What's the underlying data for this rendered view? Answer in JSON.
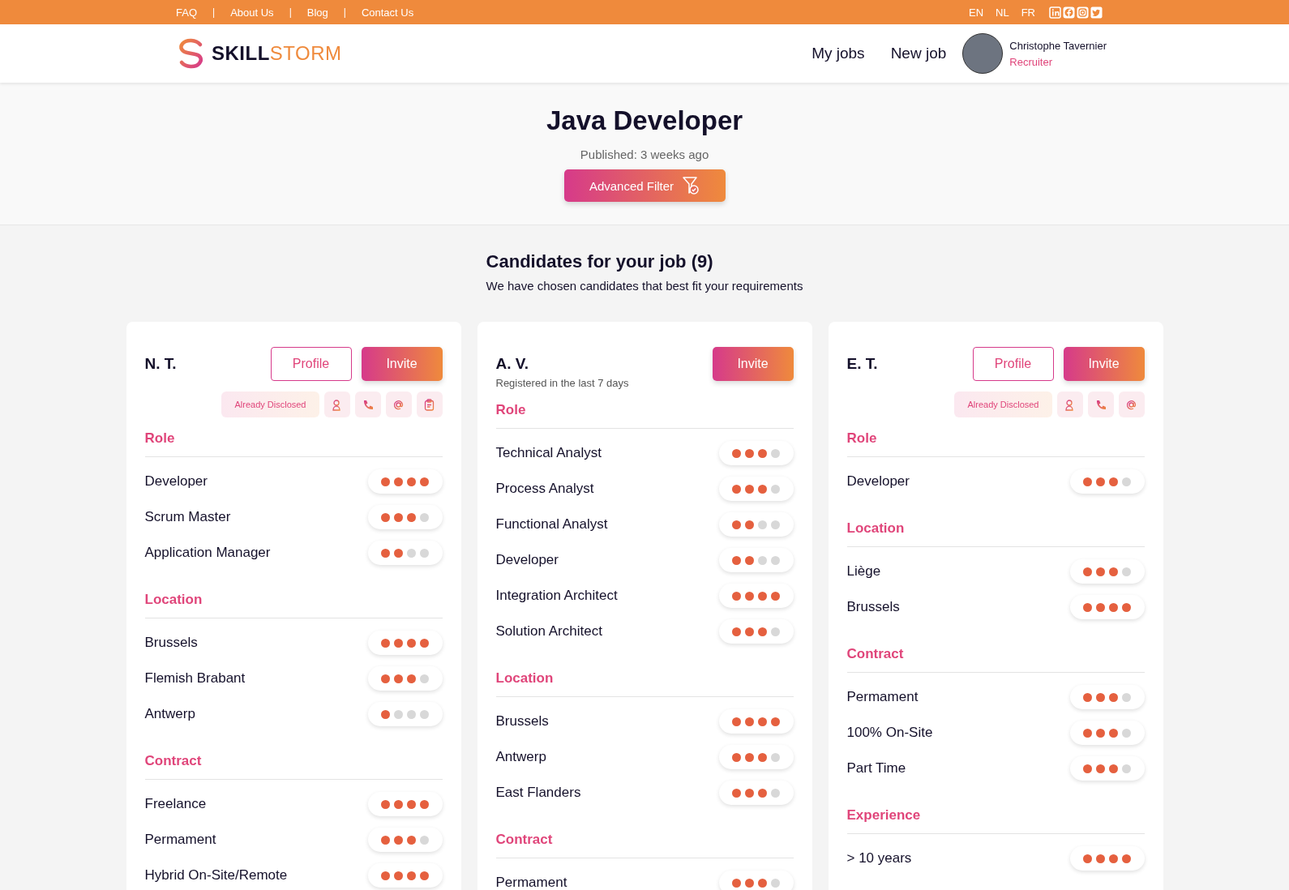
{
  "top_bar": {
    "links": [
      "FAQ",
      "About Us",
      "Blog",
      "Contact Us"
    ],
    "separators": [
      "|",
      "|",
      "|"
    ],
    "languages": [
      "EN",
      "NL",
      "FR"
    ]
  },
  "header": {
    "logo": {
      "first": "SKILL",
      "second": "STORM"
    },
    "nav": [
      "My jobs",
      "New job"
    ],
    "user": {
      "name": "Christophe Tavernier",
      "role": "Recruiter"
    }
  },
  "job": {
    "title": "Java Developer",
    "published": "Published: 3 weeks ago",
    "filter_button": "Advanced Filter"
  },
  "candidates": {
    "title": "Candidates for your job (9)",
    "subtitle": "We have chosen candidates that best fit your requirements",
    "cards": [
      {
        "name": "N. T.",
        "profile_button": "Profile",
        "invite_button": "Invite",
        "disclosure": {
          "label": "Already Disclosed",
          "contact_buttons": [
            {
              "kind": "person"
            },
            {
              "kind": "phone"
            },
            {
              "kind": "email"
            },
            {
              "kind": "clipboard"
            }
          ]
        },
        "sections": [
          {
            "title": "Role",
            "items": [
              {
                "label": "Developer",
                "stars": 4
              },
              {
                "label": "Scrum Master",
                "stars": 3
              },
              {
                "label": "Application Manager",
                "stars": 2
              }
            ]
          },
          {
            "title": "Location",
            "items": [
              {
                "label": "Brussels",
                "stars": 4
              },
              {
                "label": "Flemish Brabant",
                "stars": 3
              },
              {
                "label": "Antwerp",
                "stars": 1
              }
            ]
          },
          {
            "title": "Contract",
            "items": [
              {
                "label": "Freelance",
                "stars": 4
              },
              {
                "label": "Permament",
                "stars": 3
              },
              {
                "label": "Hybrid On-Site/Remote",
                "stars": 4
              }
            ]
          }
        ]
      },
      {
        "name": "A. V.",
        "note": "Registered in the last 7 days",
        "invite_button": "Invite",
        "sections": [
          {
            "title": "Role",
            "items": [
              {
                "label": "Technical Analyst",
                "stars": 3
              },
              {
                "label": "Process Analyst",
                "stars": 3
              },
              {
                "label": "Functional Analyst",
                "stars": 2
              },
              {
                "label": "Developer",
                "stars": 2
              },
              {
                "label": "Integration Architect",
                "stars": 4
              },
              {
                "label": "Solution Architect",
                "stars": 3
              }
            ]
          },
          {
            "title": "Location",
            "items": [
              {
                "label": "Brussels",
                "stars": 4
              },
              {
                "label": "Antwerp",
                "stars": 3
              },
              {
                "label": "East Flanders",
                "stars": 3
              }
            ]
          },
          {
            "title": "Contract",
            "items": [
              {
                "label": "Permament",
                "stars": 3
              }
            ]
          }
        ]
      },
      {
        "name": "E. T.",
        "profile_button": "Profile",
        "invite_button": "Invite",
        "disclosure": {
          "label": "Already Disclosed",
          "contact_buttons": [
            {
              "kind": "person"
            },
            {
              "kind": "phone"
            },
            {
              "kind": "email"
            }
          ]
        },
        "sections": [
          {
            "title": "Role",
            "items": [
              {
                "label": "Developer",
                "stars": 3
              }
            ]
          },
          {
            "title": "Location",
            "items": [
              {
                "label": "Liège",
                "stars": 3
              },
              {
                "label": "Brussels",
                "stars": 4
              }
            ]
          },
          {
            "title": "Contract",
            "items": [
              {
                "label": "Permament",
                "stars": 3
              },
              {
                "label": "100% On-Site",
                "stars": 3
              },
              {
                "label": "Part Time",
                "stars": 3
              }
            ]
          },
          {
            "title": "Experience",
            "items": [
              {
                "label": "> 10 years",
                "stars": 4
              }
            ]
          }
        ]
      }
    ]
  }
}
